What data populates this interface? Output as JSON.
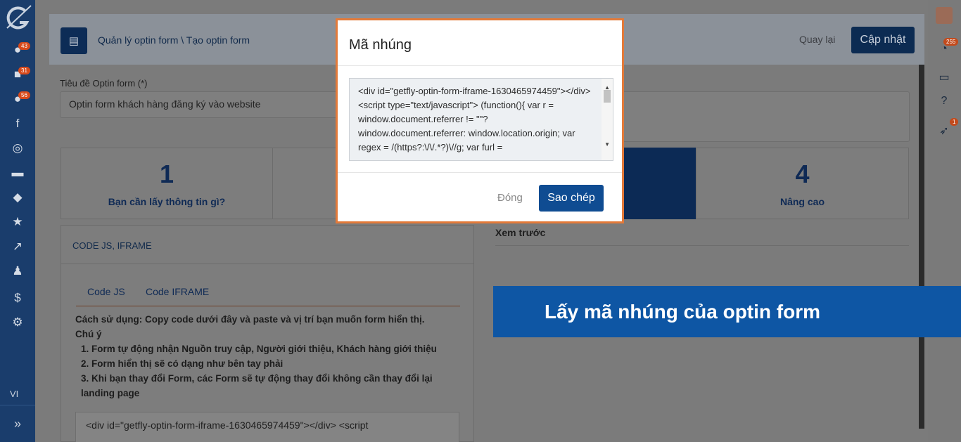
{
  "sidebar": {
    "badges": [
      "43",
      "31",
      "56"
    ],
    "lang": "VI"
  },
  "rightbar": {
    "notif_badge": "255",
    "rocket_badge": "1"
  },
  "header": {
    "breadcrumb": "Quản lý optin form \\ Tạo optin form",
    "back": "Quay lại",
    "update": "Cập nhật"
  },
  "form": {
    "title_label": "Tiêu đề Optin form (*)",
    "title_value": "Optin form khách hàng đăng ký vào website"
  },
  "steps": [
    {
      "num": "1",
      "label": "Bạn cần lấy thông tin gì?"
    },
    {
      "num": "4",
      "label": "Nâng cao"
    }
  ],
  "panel": {
    "title": "CODE JS, IFRAME",
    "tabs": [
      "Code JS",
      "Code IFRAME"
    ],
    "usage": "Cách sử dụng: Copy code dưới đây và paste và vị trí bạn muốn form hiển thị.",
    "note": "Chú ý",
    "items": [
      "1. Form tự động nhận Nguồn truy cập, Người giới thiệu, Khách hàng giới thiệu",
      "2. Form hiển thị sẽ có dạng như bên tay phải",
      "3. Khi bạn thay đổi Form, các Form sẽ tự động thay đổi không cần thay đổi lại landing page"
    ],
    "code_preview": "<div id=\"getfly-optin-form-iframe-1630465974459\"></div> <script"
  },
  "preview": {
    "label": "Xem trước"
  },
  "banner": {
    "text": "Lấy mã nhúng của optin form"
  },
  "modal": {
    "title": "Mã nhúng",
    "code": "<div id=\"getfly-optin-form-iframe-1630465974459\"></div> <script type=\"text/javascript\"> (function(){ var r = window.document.referrer != \"\"? window.document.referrer: window.location.origin; var regex = /(https?:\\/\\/.*?)\\//g; var furl =",
    "close": "Đóng",
    "copy": "Sao chép"
  },
  "colors": {
    "sidebar": "#1a3d6c",
    "primary": "#0f4c92",
    "banner": "#0e56a4",
    "modal_border": "#e37a3a"
  }
}
